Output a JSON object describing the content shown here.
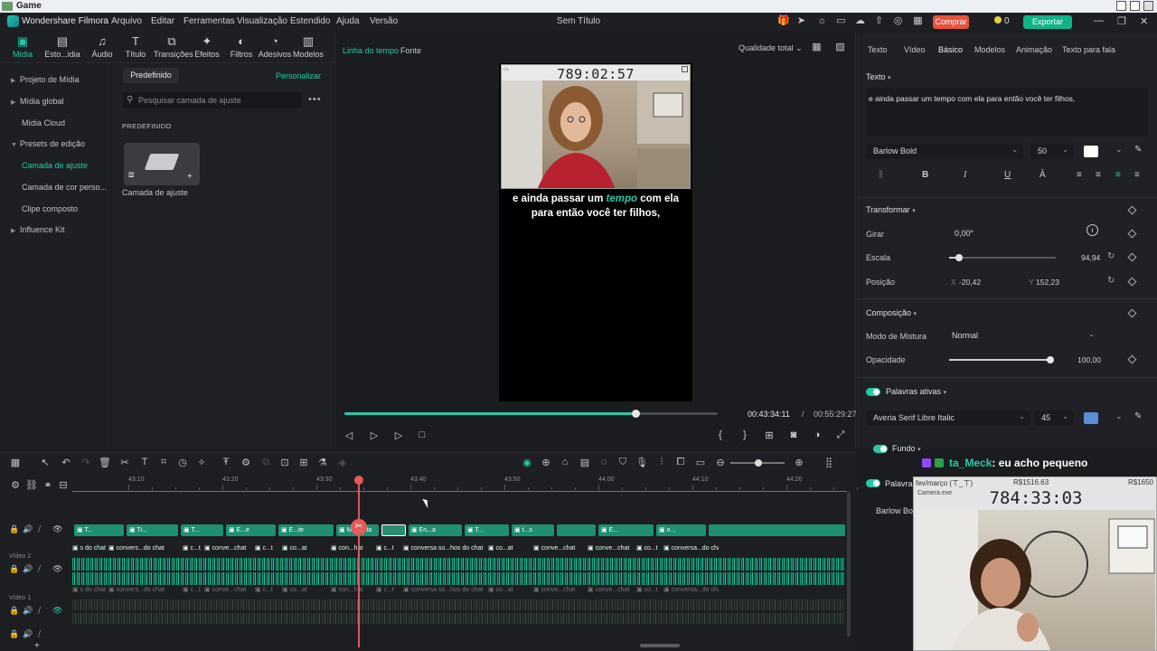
{
  "os": {
    "title": "Game"
  },
  "app": {
    "name": "Wondershare Filmora",
    "menu": [
      "Arquivo",
      "Editar",
      "Ferramentas",
      "Visualização",
      "Estendido",
      "Ajuda",
      "Versão"
    ],
    "doc_title": "Sem Título",
    "buy_label": "Comprar",
    "coins": "0",
    "export_label": "Exportar"
  },
  "tools": [
    "Mídia",
    "Esto...idia",
    "Áudio",
    "Título",
    "Transições",
    "Efeitos",
    "Filtros",
    "Adesivos",
    "Modelos"
  ],
  "leftnav": {
    "items": [
      "Projeto de Mídia",
      "Mídia global",
      "Mídia Cloud",
      "Presets de edição",
      "Camada de ajuste",
      "Camada de cor perso...",
      "Clipe composto",
      "Influence Kit"
    ]
  },
  "midpanel": {
    "tab": "Predefinido",
    "personalize": "Personalizar",
    "search_placeholder": "Pesquisar camada de ajuste",
    "section": "PREDEFINIDO",
    "item_label": "Camada de ajuste"
  },
  "preview": {
    "tabs": [
      "Linha do tempo",
      "Fonte"
    ],
    "quality": "Qualidade total",
    "overlay_counter": "789:02:57",
    "caption_before": "e ainda passar um ",
    "caption_highlight": "tempo",
    "caption_after": " com ela para então você ter filhos,",
    "progress": 0.78,
    "time_current": "00:43:34:11",
    "time_sep": "/",
    "time_total": "00:55:29:27"
  },
  "props": {
    "tabs": [
      "Texto",
      "Vídeo",
      "Básico",
      "Modelos",
      "Animação",
      "Texto para fala"
    ],
    "text_header": "Texto",
    "text_value": "e ainda passar um tempo com ela para então você ter filhos,",
    "font": "Barlow Bold",
    "font_size": "50",
    "transform_header": "Transformar",
    "rotate_label": "Girar",
    "rotate_value": "0,00°",
    "scale_label": "Escala",
    "scale_value": "94,94",
    "scale_level": 0.09,
    "position_label": "Posição",
    "pos_x_label": "X",
    "pos_x": "-20,42",
    "pos_y_label": "Y",
    "pos_y": "152,23",
    "comp_header": "Composição",
    "blend_label": "Modo de Mistura",
    "blend_value": "Normal",
    "opacity_label": "Opacidade",
    "opacity_value": "100,00",
    "opacity_level": 1.0,
    "active_words_header": "Palavras ativas",
    "aw_font": "Averia Serif Libre Italic",
    "aw_size": "45",
    "fundo": "Fundo",
    "palavras2": "Palavras",
    "barlow2": "Barlow Bold"
  },
  "timeline": {
    "ticks": [
      "43:10",
      "43:20",
      "43:30",
      "43:40",
      "43:50",
      "44:00",
      "44:10",
      "44:20"
    ],
    "track_video2": "Vídeo 2",
    "track_video1": "Vídeo 1",
    "title_clips": [
      "T... ",
      "Ti...",
      "T...",
      "E...e",
      "E...te",
      "Ma...erta",
      "",
      "En...a",
      "T...",
      "t...s",
      "",
      "E...",
      "o..."
    ],
    "audio_clips": [
      "s do chat",
      "convers...do chat",
      "c...t",
      "conve...chat",
      "c...t",
      "co...at",
      "con...hat",
      "c...t",
      "conversa so...hos do chat",
      "co...at",
      "conve...chat",
      "conve...chat",
      "co...t",
      "conversa...do chat"
    ]
  },
  "stream": {
    "chat_user": "ta_Meck",
    "chat_msg": ": eu acho pequeno",
    "cam_header": "fev/março (ㄒ_ㄒ)",
    "cam_price": "R$1516.63",
    "cam_price2": "R$1650",
    "cam_label": "Camera.exe",
    "cam_counter": "784:33:03"
  },
  "colors": {
    "accent": "#25c9a9",
    "buy": "#e7533f",
    "export": "#10b488",
    "playhead": "#e35a5a"
  }
}
